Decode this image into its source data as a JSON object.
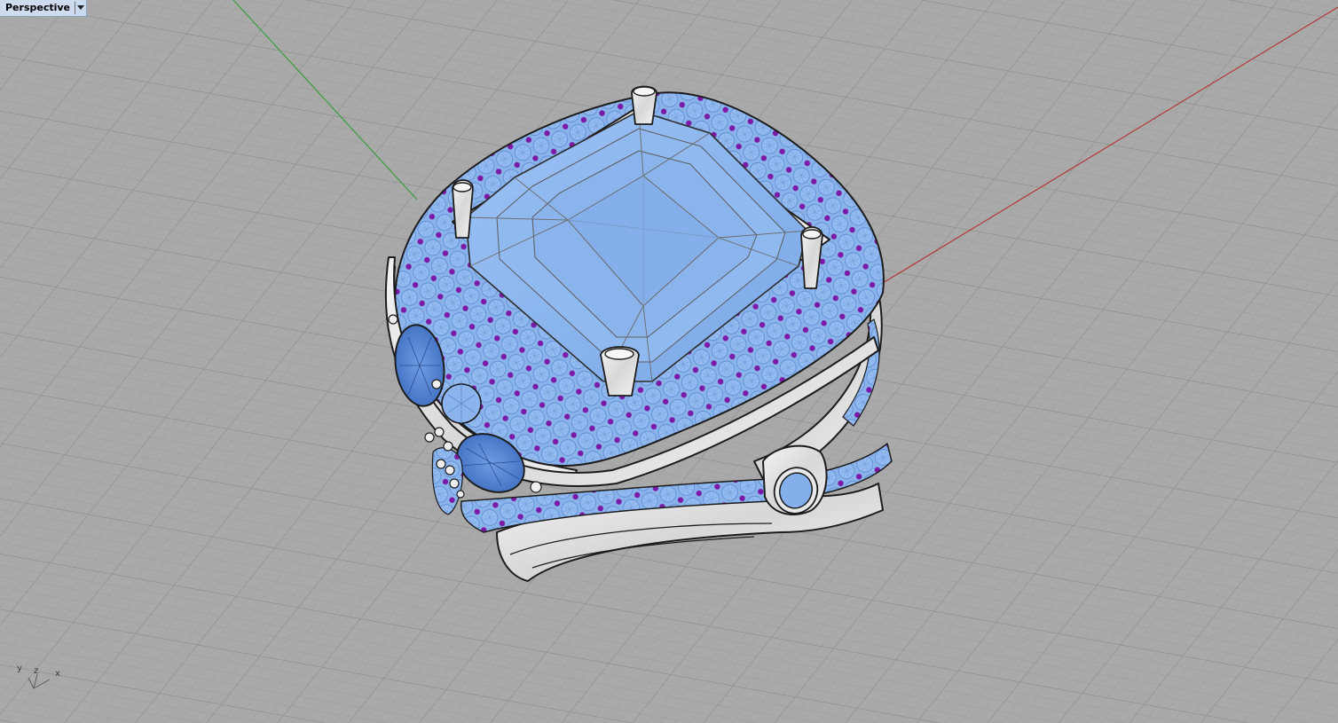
{
  "viewport": {
    "title": "Perspective",
    "menu_icon": "chevron-down-icon"
  },
  "axes_widget": {
    "y_label": "y",
    "z_label": "z",
    "x_label": "x"
  },
  "colors": {
    "background": "#a9a9a9",
    "grid_minor": "#9c9c9c",
    "grid_major": "#8f8f8f",
    "x_axis": "#b13b3b",
    "y_axis": "#3a9d3a",
    "gem_blue": "#8bb4ec",
    "gem_blue_dark": "#5a86d0",
    "prong_purple": "#7a1aa6",
    "metal": "#e6e6e6",
    "outline": "#1c1c1c"
  },
  "model": {
    "name": "ring"
  }
}
